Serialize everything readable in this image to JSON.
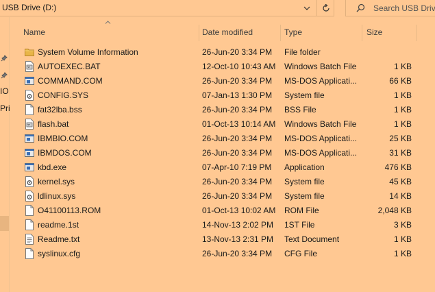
{
  "address": {
    "path": "USB Drive (D:)"
  },
  "search": {
    "placeholder": "Search USB Drive"
  },
  "nav": {
    "labels": [
      "IO",
      "Pri"
    ]
  },
  "columns": {
    "name": "Name",
    "date": "Date modified",
    "type": "Type",
    "size": "Size"
  },
  "files": [
    {
      "name": "System Volume Information",
      "date": "26-Jun-20 3:34 PM",
      "type": "File folder",
      "size": "",
      "icon": "folder-icon"
    },
    {
      "name": "AUTOEXEC.BAT",
      "date": "12-Oct-10 10:43 AM",
      "type": "Windows Batch File",
      "size": "1 KB",
      "icon": "batch-file-icon"
    },
    {
      "name": "COMMAND.COM",
      "date": "26-Jun-20 3:34 PM",
      "type": "MS-DOS Applicati...",
      "size": "66 KB",
      "icon": "application-icon"
    },
    {
      "name": "CONFIG.SYS",
      "date": "07-Jan-13 1:30 PM",
      "type": "System file",
      "size": "1 KB",
      "icon": "system-file-icon"
    },
    {
      "name": "fat32lba.bss",
      "date": "26-Jun-20 3:34 PM",
      "type": "BSS File",
      "size": "1 KB",
      "icon": "file-icon"
    },
    {
      "name": "flash.bat",
      "date": "01-Oct-13 10:14 AM",
      "type": "Windows Batch File",
      "size": "1 KB",
      "icon": "batch-file-icon"
    },
    {
      "name": "IBMBIO.COM",
      "date": "26-Jun-20 3:34 PM",
      "type": "MS-DOS Applicati...",
      "size": "25 KB",
      "icon": "application-icon"
    },
    {
      "name": "IBMDOS.COM",
      "date": "26-Jun-20 3:34 PM",
      "type": "MS-DOS Applicati...",
      "size": "31 KB",
      "icon": "application-icon"
    },
    {
      "name": "kbd.exe",
      "date": "07-Apr-10 7:19 PM",
      "type": "Application",
      "size": "476 KB",
      "icon": "application-icon"
    },
    {
      "name": "kernel.sys",
      "date": "26-Jun-20 3:34 PM",
      "type": "System file",
      "size": "45 KB",
      "icon": "system-file-icon"
    },
    {
      "name": "ldlinux.sys",
      "date": "26-Jun-20 3:34 PM",
      "type": "System file",
      "size": "14 KB",
      "icon": "system-file-icon"
    },
    {
      "name": "O41100113.ROM",
      "date": "01-Oct-13 10:02 AM",
      "type": "ROM File",
      "size": "2,048 KB",
      "icon": "file-icon"
    },
    {
      "name": "readme.1st",
      "date": "14-Nov-13 2:02 PM",
      "type": "1ST File",
      "size": "3 KB",
      "icon": "file-icon"
    },
    {
      "name": "Readme.txt",
      "date": "13-Nov-13 2:31 PM",
      "type": "Text Document",
      "size": "1 KB",
      "icon": "text-document-icon"
    },
    {
      "name": "syslinux.cfg",
      "date": "26-Jun-20 3:34 PM",
      "type": "CFG File",
      "size": "1 KB",
      "icon": "file-icon"
    }
  ]
}
